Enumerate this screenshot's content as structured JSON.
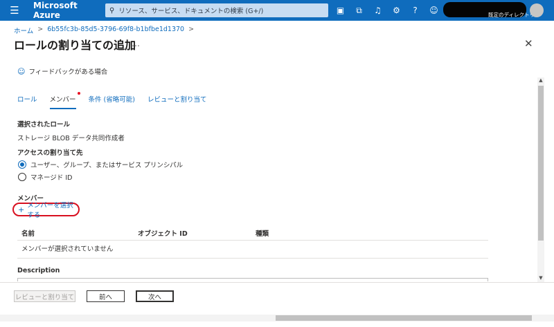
{
  "topbar": {
    "brand": "Microsoft Azure",
    "search_placeholder": "リソース、サービス、ドキュメントの検索 (G+/)",
    "account_subtext": "既定のディレクトリ"
  },
  "breadcrumb": [
    "ホーム",
    "6b55fc3b-85d5-3796-69f8-b1bfbe1d1370"
  ],
  "page": {
    "title": "ロールの割り当ての追加",
    "more": "…",
    "feedback": "フィードバックがある場合"
  },
  "tabs": [
    {
      "label": "ロール"
    },
    {
      "label": "メンバー"
    },
    {
      "label": "条件 (省略可能)"
    },
    {
      "label": "レビューと割り当て"
    }
  ],
  "form": {
    "selected_role_label": "選択されたロール",
    "selected_role_value": "ストレージ BLOB データ共同作成者",
    "assign_to_label": "アクセスの割り当て先",
    "options": [
      {
        "label": "ユーザー、グループ、またはサービス プリンシパル",
        "checked": true
      },
      {
        "label": "マネージド ID",
        "checked": false
      }
    ],
    "members_label": "メンバー",
    "select_members": "メンバーを選択する",
    "table_headers": [
      "名前",
      "オブジェクト ID",
      "種類"
    ],
    "table_empty": "メンバーが選択されていません",
    "description_label": "Description"
  },
  "footer": {
    "review_assign": "レビューと割り当て",
    "previous": "前へ",
    "next": "次へ"
  }
}
